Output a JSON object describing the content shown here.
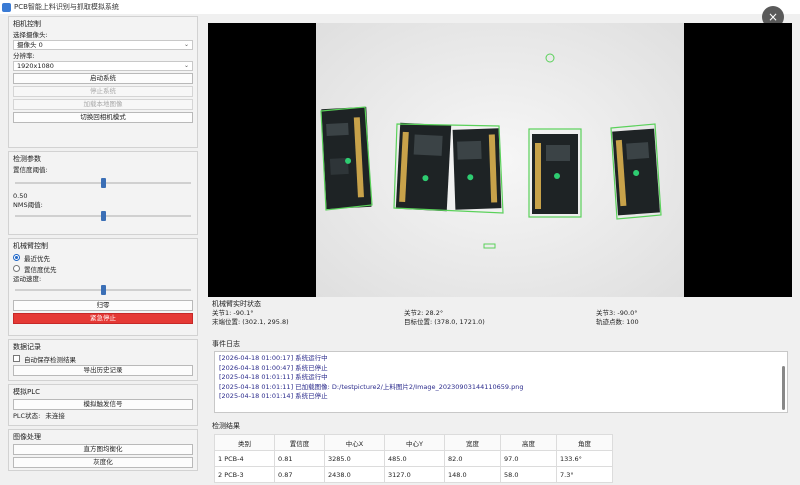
{
  "window": {
    "title": "PCB智能上料识别与抓取模拟系统",
    "close_glyph": "×"
  },
  "camera_control": {
    "title": "相机控制",
    "select_camera_label": "选择摄像头:",
    "camera_value": "摄像头 0",
    "resolution_label": "分辨率:",
    "resolution_value": "1920x1080",
    "start_button": "启动系统",
    "stop_button": "停止系统",
    "load_image_button": "加载本地图像",
    "switch_mode_button": "切换回相机模式"
  },
  "detect_params": {
    "title": "检测参数",
    "confidence_label": "置信度阈值:",
    "confidence_level": 0.5,
    "confidence_value": "0.50",
    "nms_label": "NMS阈值:",
    "nms_level": 0.5
  },
  "arm_control": {
    "title": "机械臂控制",
    "option_nearest": "最近优先",
    "option_confidence": "置信度优先",
    "speed_label": "运动速度:",
    "speed_level": 0.5,
    "home_button": "归零",
    "estop_button": "紧急停止"
  },
  "data_record": {
    "title": "数据记录",
    "autosave_label": "自动保存检测结果",
    "export_button": "导出历史记录"
  },
  "plc": {
    "title": "模拟PLC",
    "trigger_button": "模拟触发信号",
    "status_label": "PLC状态:",
    "status_value": "未连接"
  },
  "image_proc": {
    "title": "图像处理",
    "equalize_button": "直方图均衡化",
    "binarize_button": "灰度化"
  },
  "arm_status": {
    "title": "机械臂实时状态",
    "joint1": "关节1: -90.1°",
    "joint2": "关节2: 28.2°",
    "joint3": "关节3: -90.0°",
    "end_pos": "末端位置: (302.1, 295.8)",
    "target_pos": "目标位置: (378.0, 1721.0)",
    "path_points": "轨迹点数: 100"
  },
  "event_log": {
    "title": "事件日志",
    "lines": [
      "[2026-04-18 01:00:17] 系统运行中",
      "[2026-04-18 01:00:47] 系统已停止",
      "[2025-04-18 01:01:11] 系统运行中",
      "[2025-04-18 01:01:11] 已加载图像: D:/testpicture2/上料图片2/Image_20230903144110659.png",
      "[2025-04-18 01:01:14] 系统已停止"
    ]
  },
  "results": {
    "title": "检测结果",
    "headers": [
      "类别",
      "置信度",
      "中心X",
      "中心Y",
      "宽度",
      "高度",
      "角度"
    ],
    "rows": [
      {
        "idx": "1",
        "cells": [
          "PCB-4",
          "0.81",
          "3285.0",
          "485.0",
          "82.0",
          "97.0",
          "133.6°"
        ]
      },
      {
        "idx": "2",
        "cells": [
          "PCB-3",
          "0.87",
          "2438.0",
          "3127.0",
          "148.0",
          "58.0",
          "7.3°"
        ]
      }
    ]
  },
  "colors": {
    "accent": "#1e66c7",
    "danger": "#e53935",
    "box": "#5ad15a"
  },
  "icons": {
    "close": "close-icon",
    "chevron": "chevron-down-icon"
  }
}
